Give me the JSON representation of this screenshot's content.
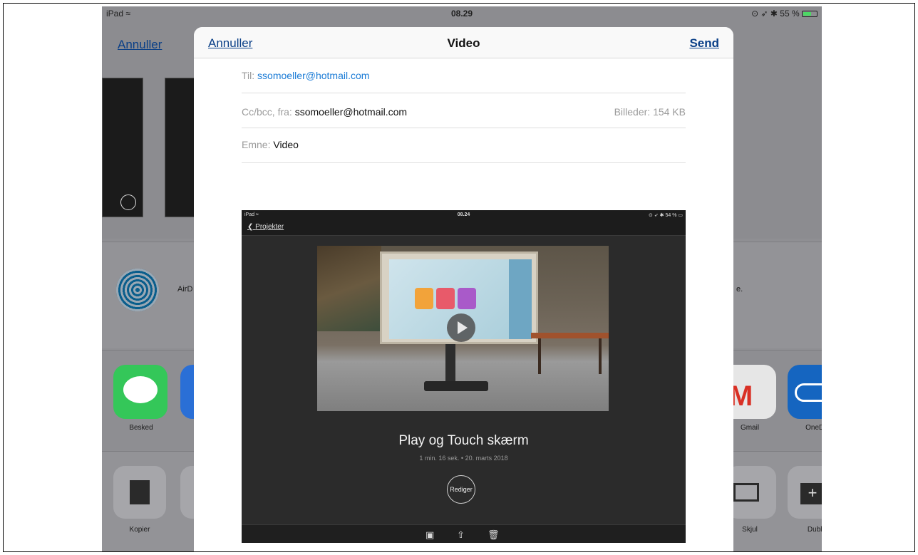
{
  "status_bar": {
    "device": "iPad",
    "time": "08.29",
    "battery": "55 %"
  },
  "background": {
    "cancel_label": "Annuller",
    "airdrop_label": "AirD",
    "apps": [
      {
        "label": "Besked",
        "color": "#34c759"
      },
      {
        "label": "Gmail",
        "color": "#e8e8e8"
      },
      {
        "label": "OneDri",
        "color": "#1565c0"
      }
    ],
    "actions": [
      {
        "label": "Kopier"
      },
      {
        "label": "Skjul"
      },
      {
        "label": "Duble"
      }
    ]
  },
  "composer": {
    "cancel_label": "Annuller",
    "title": "Video",
    "send_label": "Send",
    "to": {
      "label": "Til:",
      "value": "ssomoeller@hotmail.com"
    },
    "cc": {
      "label": "Cc/bcc, fra:",
      "value": "ssomoeller@hotmail.com",
      "size": "Billeder: 154 KB"
    },
    "subject": {
      "label": "Emne:",
      "value": "Video"
    }
  },
  "attachment": {
    "status": {
      "device": "iPad",
      "time": "08.24",
      "battery": "54 %"
    },
    "back_label": "Projekter",
    "video_title": "Play og Touch skærm",
    "video_meta": "1 min. 16 sek. • 20. marts 2018",
    "edit_label": "Rediger"
  },
  "colors": {
    "link": "#0a3f87",
    "accent_blue": "#1a7bd6"
  }
}
